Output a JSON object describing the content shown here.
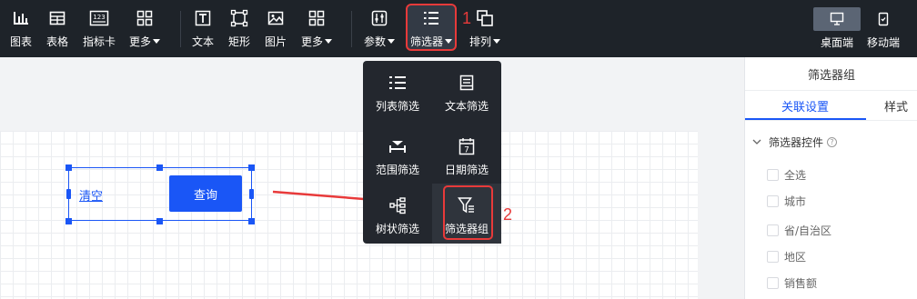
{
  "toolbar": {
    "chart": "图表",
    "table": "表格",
    "indicator": "指标卡",
    "more1": "更多",
    "text": "文本",
    "rect": "矩形",
    "image": "图片",
    "more2": "更多",
    "params": "参数",
    "filter": "筛选器",
    "arrange": "排列",
    "indicator_badge": "123",
    "desktop": "桌面端",
    "mobile": "移动端"
  },
  "annotations": {
    "step1": "1",
    "step2": "2"
  },
  "dropdown": {
    "items": [
      {
        "label": "列表筛选",
        "icon": "list-filter-icon"
      },
      {
        "label": "文本筛选",
        "icon": "text-filter-icon"
      },
      {
        "label": "范围筛选",
        "icon": "range-filter-icon"
      },
      {
        "label": "日期筛选",
        "icon": "date-filter-icon",
        "day": "7"
      },
      {
        "label": "树状筛选",
        "icon": "tree-filter-icon"
      },
      {
        "label": "筛选器组",
        "icon": "filter-group-icon"
      }
    ]
  },
  "canvas": {
    "clear": "清空",
    "query": "查询"
  },
  "panel": {
    "title": "筛选器组",
    "tab_linkage": "关联设置",
    "tab_style": "样式",
    "group_label": "筛选器控件",
    "help": "?",
    "options": [
      "全选",
      "城市",
      "省/自治区",
      "地区",
      "销售额"
    ]
  },
  "colors": {
    "toolbar_bg": "#1e2329",
    "accent": "#1a56f6",
    "highlight": "#e83a3a"
  }
}
